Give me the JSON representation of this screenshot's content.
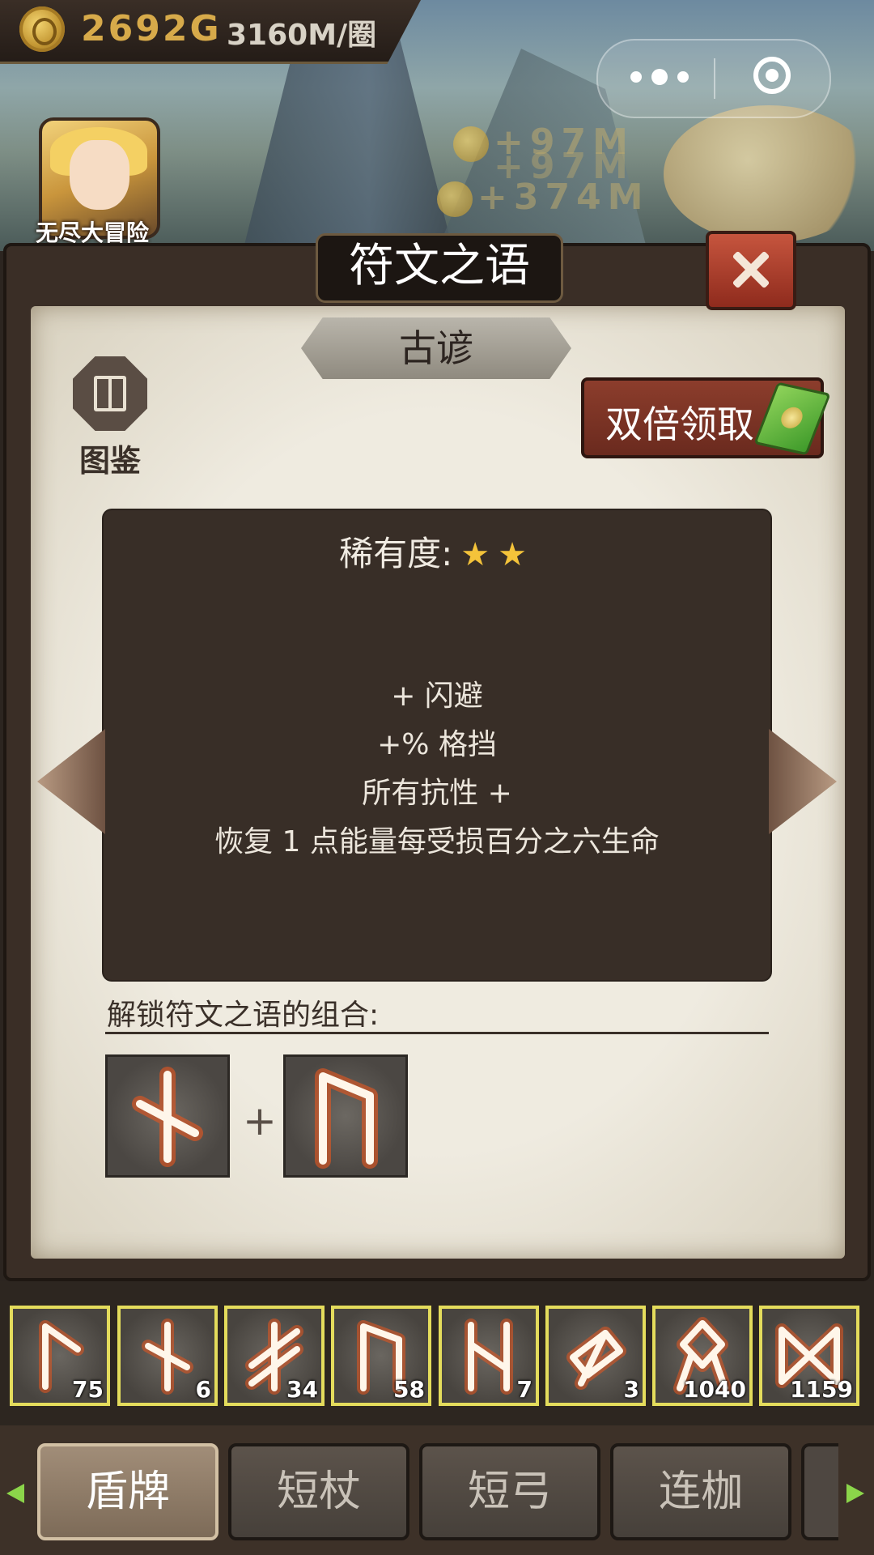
{
  "header": {
    "gold_amount": "2692G",
    "gold_rate": "3160M/圈",
    "floating_gains": [
      "+97M",
      "+97M",
      "+374M"
    ],
    "game_caption": "无尽大冒险"
  },
  "dialog": {
    "title": "符文之语",
    "subtitle": "古谚",
    "codex_label": "图鉴",
    "double_claim_label": "双倍领取",
    "rarity_label": "稀有度:",
    "rarity_stars": 2,
    "rarity_stars_text": "★★",
    "attributes": [
      "+ 闪避",
      "+% 格挡",
      "所有抗性 +",
      "恢复 1 点能量每受损百分之六生命"
    ],
    "combo_title": "解锁符文之语的组合:",
    "combo_plus": "+"
  },
  "inventory": [
    {
      "count": "75"
    },
    {
      "count": "6"
    },
    {
      "count": "34"
    },
    {
      "count": "58"
    },
    {
      "count": "7"
    },
    {
      "count": "3"
    },
    {
      "count": "1040"
    },
    {
      "count": "1159"
    }
  ],
  "tabs": [
    {
      "label": "盾牌",
      "active": true
    },
    {
      "label": "短杖",
      "active": false
    },
    {
      "label": "短弓",
      "active": false
    },
    {
      "label": "连枷",
      "active": false
    }
  ],
  "colors": {
    "accent_gold": "#d7aa4a",
    "inventory_border": "#e4dc5c",
    "rune_glow": "#e8561e",
    "tab_arrow": "#8bd54a"
  },
  "icons": {
    "gold": "gold-coin-icon",
    "codex": "book-icon",
    "close": "close-icon",
    "ticket": "ticket-icon",
    "more": "more-dots-icon",
    "target": "target-icon"
  }
}
